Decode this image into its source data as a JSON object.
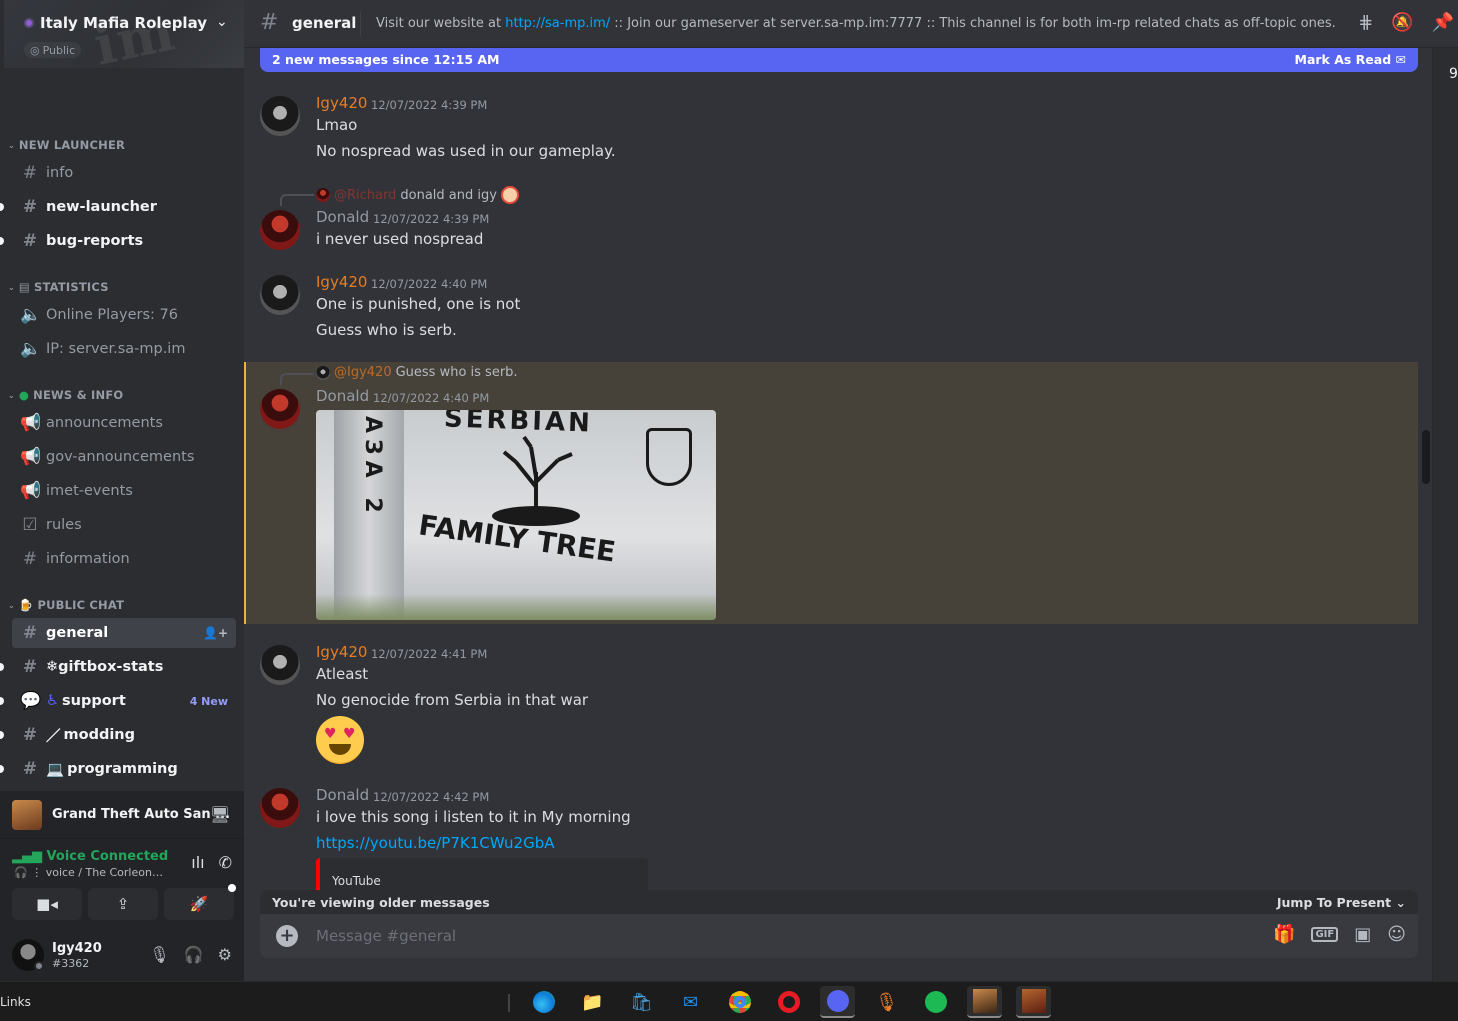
{
  "server": {
    "name": "Italy Mafia Roleplay",
    "badge": "Public"
  },
  "categories": [
    {
      "label": "NEW LAUNCHER"
    },
    {
      "label": "STATISTICS"
    },
    {
      "label": "NEWS & INFO"
    },
    {
      "label": "PUBLIC CHAT"
    }
  ],
  "channels": {
    "info": "info",
    "new_launcher": "new-launcher",
    "bug_reports": "bug-reports",
    "online_players": "Online Players: 76",
    "ip": "IP: server.sa-mp.im",
    "announcements": "announcements",
    "gov_announcements": "gov-announcements",
    "imet_events": "imet-events",
    "rules": "rules",
    "information": "information",
    "general": "general",
    "giftbox": "❄giftbox-stats",
    "support": "support",
    "support_badge": "4 New",
    "modding": "modding",
    "programming": "programming"
  },
  "activity": {
    "name": "Grand Theft Auto San ..."
  },
  "voice": {
    "status": "Voice Connected",
    "channel": "voice / The Corleone ..."
  },
  "user": {
    "name": "Igy420",
    "tag": "#3362"
  },
  "header": {
    "channel": "general",
    "topic_pre": "Visit our website at ",
    "topic_link": "http://sa-mp.im/",
    "topic_post": " :: Join our gameserver at server.sa-mp.im:7777 :: This channel is for both im-rp related chats as off-topic ones."
  },
  "new_bar": {
    "text": "2 new messages since 12:15 AM",
    "action": "Mark As Read"
  },
  "messages": [
    {
      "author": "Igy420",
      "time": "12/07/2022 4:39 PM",
      "lines": [
        "Lmao",
        "No nospread was used in our gameplay."
      ]
    },
    {
      "reply_mention": "@Richard",
      "reply_text": "donald and igy",
      "author": "Donald",
      "time": "12/07/2022 4:39 PM",
      "lines": [
        "i never used nospread"
      ]
    },
    {
      "author": "Igy420",
      "time": "12/07/2022 4:40 PM",
      "lines": [
        "One is punished, one is not",
        "Guess who is serb."
      ]
    },
    {
      "reply_mention": "@Igy420",
      "reply_text": "Guess who is serb.",
      "author": "Donald",
      "time": "12/07/2022 4:40 PM",
      "image_text": {
        "top": "SERBIAN",
        "left": "АЗА 2",
        "bottom": "FAMILY TREE"
      }
    },
    {
      "author": "Igy420",
      "time": "12/07/2022 4:41 PM",
      "lines": [
        "Atleast",
        "No genocide from Serbia in that war"
      ]
    },
    {
      "author": "Donald",
      "time": "12/07/2022 4:42 PM",
      "lines": [
        "i love this song i listen to it in My morning"
      ],
      "link": "https://youtu.be/P7K1CWu2GbA",
      "embed_provider": "YouTube"
    }
  ],
  "older_bar": {
    "text": "You're viewing older messages",
    "action": "Jump To Present"
  },
  "composer": {
    "placeholder": "Message #general"
  },
  "right_strip": {
    "count": "9"
  },
  "taskbar": {
    "links": "Links"
  },
  "colors": {
    "accent": "#5865f2",
    "link": "#00a8fc",
    "igy": "#e67e22",
    "highlight": "#f0b232",
    "voice": "#23a55a"
  }
}
